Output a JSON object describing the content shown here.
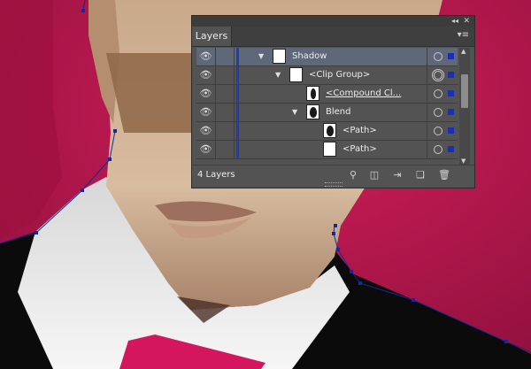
{
  "panel": {
    "title_controls": {
      "collapse": "◂◂",
      "close": "✕"
    },
    "tab_label": "Layers",
    "tab_menu_icon": "panel-menu-icon",
    "layers": [
      {
        "name": "Shadow",
        "level": 0,
        "expanded": true,
        "selected": true,
        "thumb": "white",
        "underlined": false
      },
      {
        "name": "<Clip Group>",
        "level": 1,
        "expanded": true,
        "selected": false,
        "thumb": "white",
        "underlined": false
      },
      {
        "name": "<Compound Cl...",
        "level": 2,
        "expanded": false,
        "selected": false,
        "thumb": "person",
        "underlined": true
      },
      {
        "name": "Blend",
        "level": 2,
        "expanded": true,
        "selected": false,
        "thumb": "dark",
        "underlined": false
      },
      {
        "name": "<Path>",
        "level": 3,
        "expanded": false,
        "selected": false,
        "thumb": "dark",
        "underlined": false
      },
      {
        "name": "<Path>",
        "level": 3,
        "expanded": false,
        "selected": false,
        "thumb": "white",
        "underlined": false
      }
    ],
    "layer_count": "4 Layers",
    "footer_buttons": [
      "locate-object-icon",
      "make-clipping-mask-icon",
      "create-sublayer-icon",
      "create-layer-icon",
      "delete-icon"
    ],
    "colors": {
      "selection": "#1c2fae",
      "layer_bar": "#1f3bbd",
      "row_selected": "#5f6878",
      "background": "#c2154f"
    }
  }
}
